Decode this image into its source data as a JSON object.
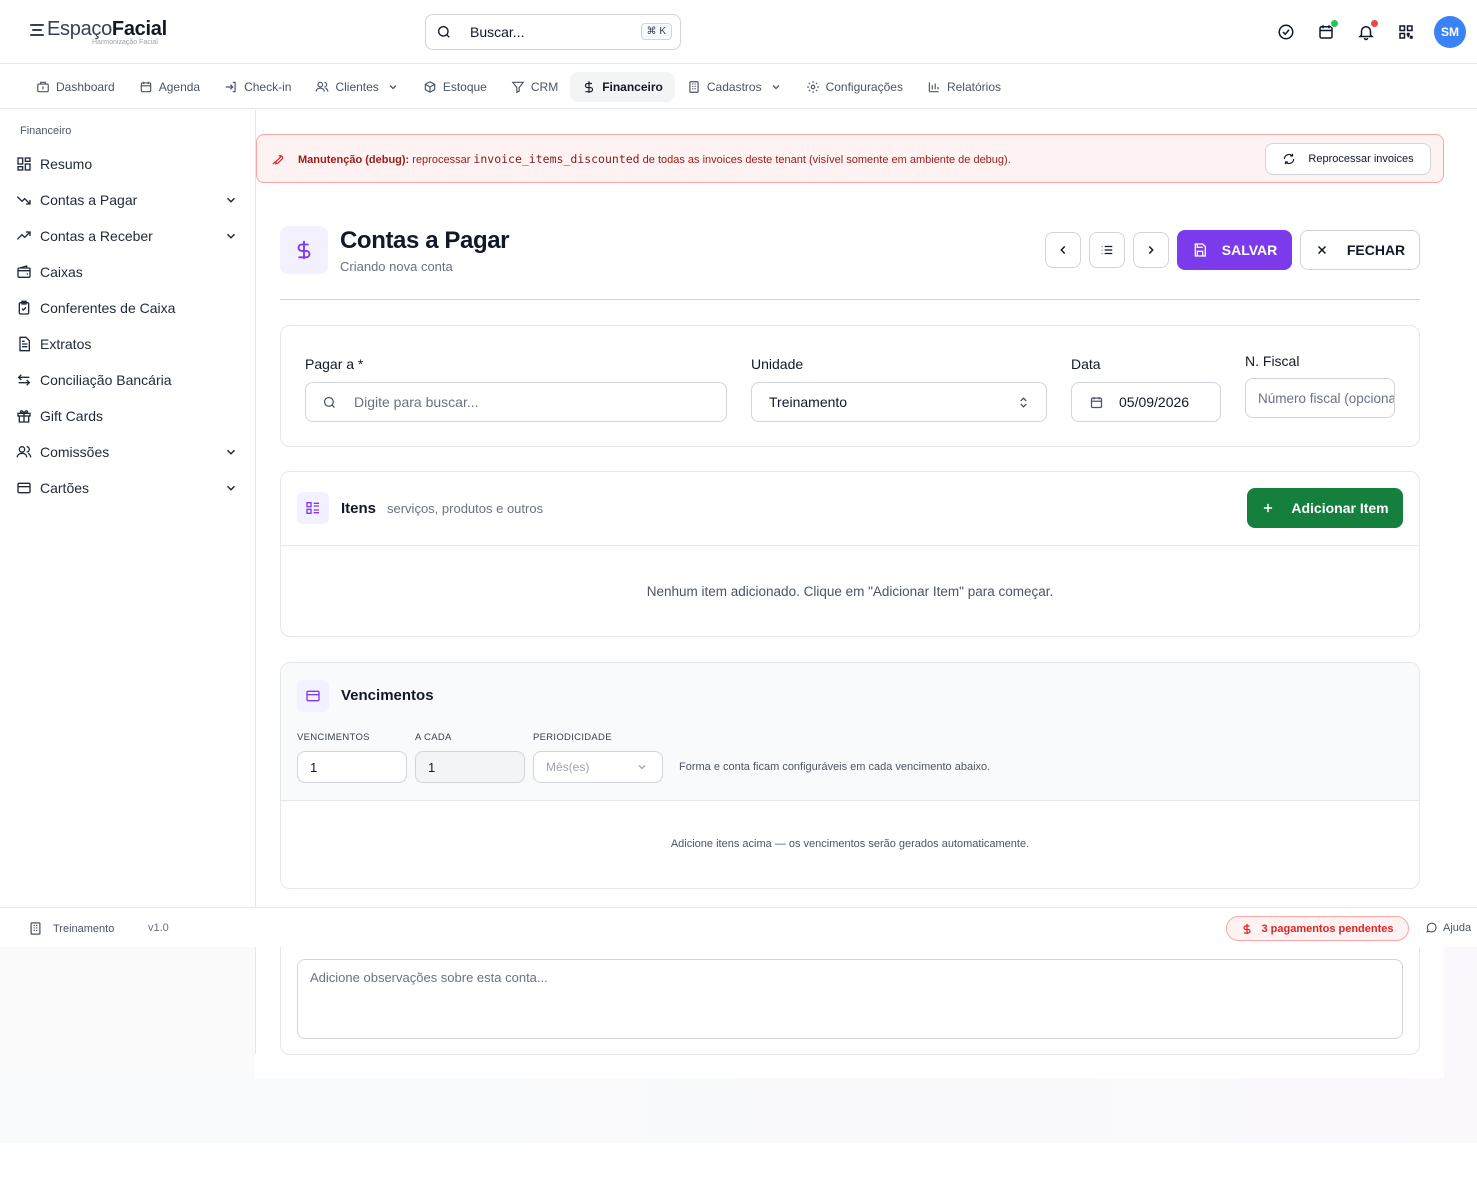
{
  "header": {
    "logo_light": "Espaço",
    "logo_bold": "Facial",
    "logo_sub": "Harmonização Facial",
    "search_placeholder": "Buscar...",
    "search_shortcut": "⌘ K",
    "avatar_initials": "SM",
    "icons": [
      "check-circle-icon",
      "calendar-status-icon",
      "bell-icon",
      "qr-code-icon"
    ],
    "status_colors": {
      "calendar_dot": "#22c55e",
      "bell_dot": "#ef4444"
    }
  },
  "nav": {
    "items": [
      {
        "label": "Dashboard",
        "icon": "dashboard-icon"
      },
      {
        "label": "Agenda",
        "icon": "calendar-icon"
      },
      {
        "label": "Check-in",
        "icon": "login-icon"
      },
      {
        "label": "Clientes",
        "icon": "users-icon",
        "dropdown": true
      },
      {
        "label": "Estoque",
        "icon": "box-icon"
      },
      {
        "label": "CRM",
        "icon": "filter-icon"
      },
      {
        "label": "Financeiro",
        "icon": "dollar-icon",
        "active": true
      },
      {
        "label": "Cadastros",
        "icon": "building-icon",
        "dropdown": true
      },
      {
        "label": "Configurações",
        "icon": "gear-icon"
      },
      {
        "label": "Relatórios",
        "icon": "bar-chart-icon"
      }
    ]
  },
  "sidebar": {
    "title": "Financeiro",
    "items": [
      {
        "label": "Resumo",
        "icon": "grid-icon"
      },
      {
        "label": "Contas a Pagar",
        "icon": "trend-down-icon",
        "dropdown": true
      },
      {
        "label": "Contas a Receber",
        "icon": "trend-up-icon",
        "dropdown": true
      },
      {
        "label": "Caixas",
        "icon": "wallet-icon"
      },
      {
        "label": "Conferentes de Caixa",
        "icon": "clipboard-check-icon"
      },
      {
        "label": "Extratos",
        "icon": "document-icon"
      },
      {
        "label": "Conciliação Bancária",
        "icon": "arrows-exchange-icon"
      },
      {
        "label": "Gift Cards",
        "icon": "gift-icon"
      },
      {
        "label": "Comissões",
        "icon": "users-icon",
        "dropdown": true
      },
      {
        "label": "Cartões",
        "icon": "credit-card-icon",
        "dropdown": true
      }
    ]
  },
  "banner": {
    "bold": "Manutenção (debug):",
    "text_before": "reprocessar",
    "code": "invoice_items_discounted",
    "text_after": "de todas as invoices deste tenant (visível somente em ambiente de debug).",
    "button": "Reprocessar invoices"
  },
  "page": {
    "title": "Contas a Pagar",
    "subtitle": "Criando nova conta",
    "save": "SALVAR",
    "close": "FECHAR",
    "accent": "#7c3aed"
  },
  "form": {
    "pagar_label": "Pagar a *",
    "pagar_placeholder": "Digite para buscar...",
    "unidade_label": "Unidade",
    "unidade_value": "Treinamento",
    "data_label": "Data",
    "data_value": "05/09/2026",
    "fiscal_label": "N. Fiscal",
    "fiscal_placeholder": "Número fiscal (opcional)"
  },
  "itens": {
    "title": "Itens",
    "subtitle": "serviços, produtos e outros",
    "add_button": "Adicionar Item",
    "empty": "Nenhum item adicionado. Clique em \"Adicionar Item\" para começar."
  },
  "vencimentos": {
    "title": "Vencimentos",
    "label_venc": "VENCIMENTOS",
    "value_venc": "1",
    "label_cada": "A CADA",
    "value_cada": "1",
    "label_period": "PERIODICIDADE",
    "value_period": "Mês(es)",
    "hint": "Forma e conta ficam configuráveis em cada vencimento abaixo.",
    "empty": "Adicione itens acima — os vencimentos serão gerados automaticamente."
  },
  "obs": {
    "placeholder": "Adicione observações sobre esta conta..."
  },
  "footer": {
    "unit": "Treinamento",
    "version": "v1.0",
    "pending": "3 pagamentos pendentes",
    "help": "Ajuda"
  }
}
